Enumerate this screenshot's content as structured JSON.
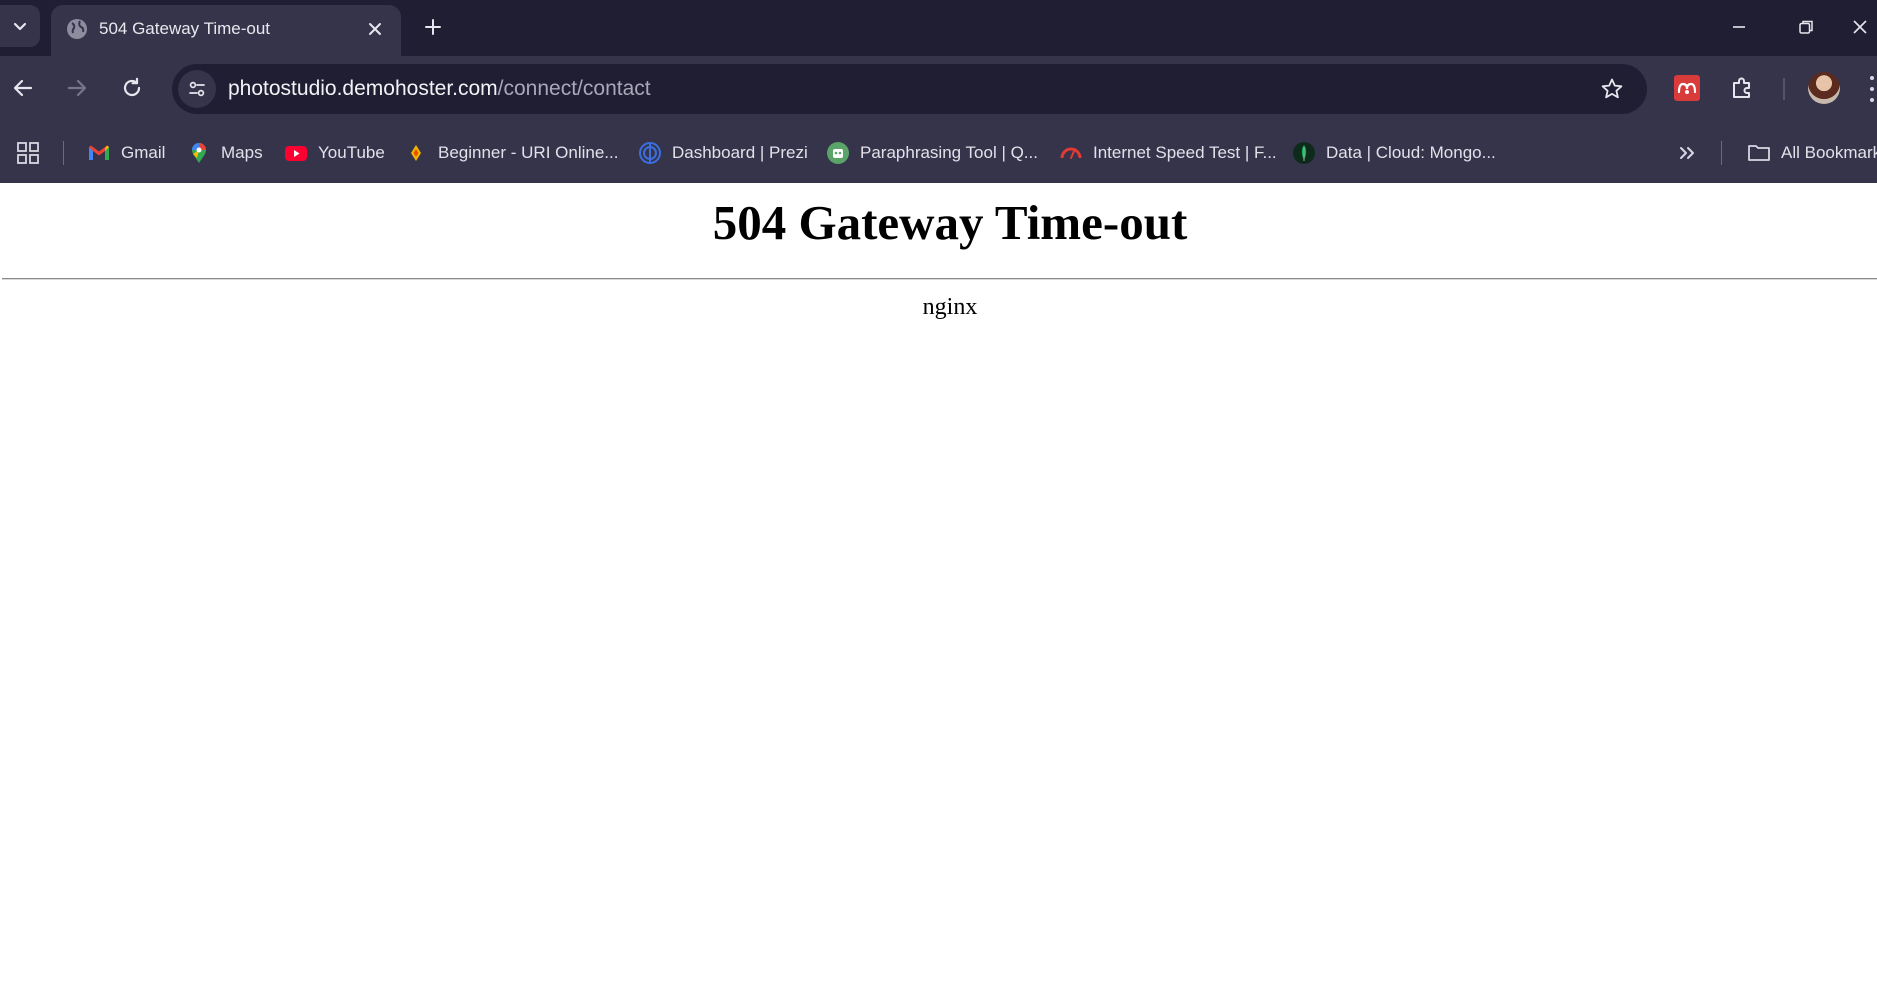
{
  "tabs": [
    {
      "title": "504 Gateway Time-out",
      "active": true,
      "favicon": "globe-icon"
    }
  ],
  "toolbar": {
    "url_host": "photostudio.demohoster.com",
    "url_path": "/connect/contact"
  },
  "bookmarks": [
    {
      "label": "Gmail",
      "icon": "gmail-icon"
    },
    {
      "label": "Maps",
      "icon": "maps-pin-icon"
    },
    {
      "label": "YouTube",
      "icon": "youtube-icon"
    },
    {
      "label": "Beginner - URI Online...",
      "icon": "uri-online-icon"
    },
    {
      "label": "Dashboard | Prezi",
      "icon": "prezi-icon"
    },
    {
      "label": "Paraphrasing Tool | Q...",
      "icon": "quillbot-icon"
    },
    {
      "label": "Internet Speed Test | F...",
      "icon": "speedometer-icon"
    },
    {
      "label": "Data | Cloud: Mongo...",
      "icon": "mongodb-leaf-icon"
    }
  ],
  "all_bookmarks_label": "All Bookmarks",
  "page": {
    "heading": "504 Gateway Time-out",
    "server": "nginx"
  },
  "colors": {
    "tabstrip_bg": "#1f1e33",
    "toolbar_bg": "#35344a",
    "page_bg": "#ffffff",
    "extension_red": "#d93a3a"
  }
}
